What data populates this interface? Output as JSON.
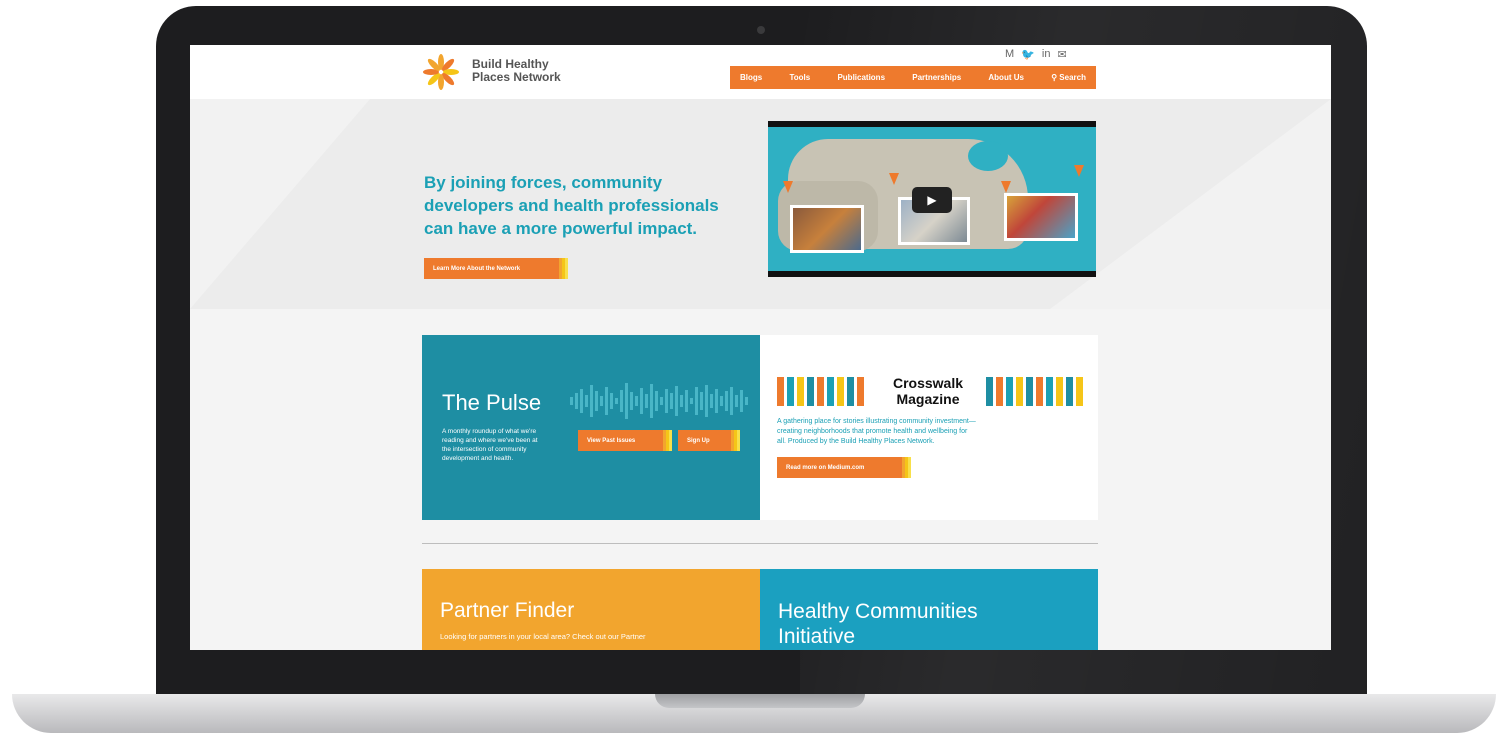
{
  "brand": {
    "name_line1": "Build Healthy",
    "name_line2": "Places Network"
  },
  "social_icons": [
    "medium-icon",
    "twitter-icon",
    "linkedin-icon",
    "email-icon"
  ],
  "social_glyphs": [
    "M",
    "🐦",
    "in",
    "✉"
  ],
  "nav": {
    "items": [
      "Blogs",
      "Tools",
      "Publications",
      "Partnerships",
      "About Us"
    ],
    "search_label": "Search"
  },
  "hero": {
    "headline_lines": [
      "By joining forces, community",
      "developers and health professionals",
      "can have a more powerful impact."
    ],
    "cta_label": "Learn More About the Network"
  },
  "pulse": {
    "title": "The Pulse",
    "description_lines": [
      "A monthly roundup of what we're",
      "reading and where we've been at",
      "the intersection of community",
      "development and health."
    ],
    "past_issues_label": "View Past Issues",
    "signup_label": "Sign Up"
  },
  "crosswalk": {
    "title_line1": "Crosswalk",
    "title_line2": "Magazine",
    "description_lines": [
      "A gathering place for stories illustrating community investment—",
      "creating neighborhoods that promote health and wellbeing for",
      "all. Produced by the Build Healthy Places Network."
    ],
    "cta_label": "Read more on Medium.com"
  },
  "partner_finder": {
    "title": "Partner Finder",
    "description": "Looking for partners in your local area? Check out our Partner"
  },
  "hci": {
    "title_line1": "Healthy Communities",
    "title_line2": "Initiative"
  },
  "colors": {
    "orange": "#ee7a2d",
    "teal": "#1ba0b5",
    "pulse_bg": "#1e8ea3",
    "partner_bg": "#f2a52e",
    "hci_bg": "#1ba0c0"
  }
}
